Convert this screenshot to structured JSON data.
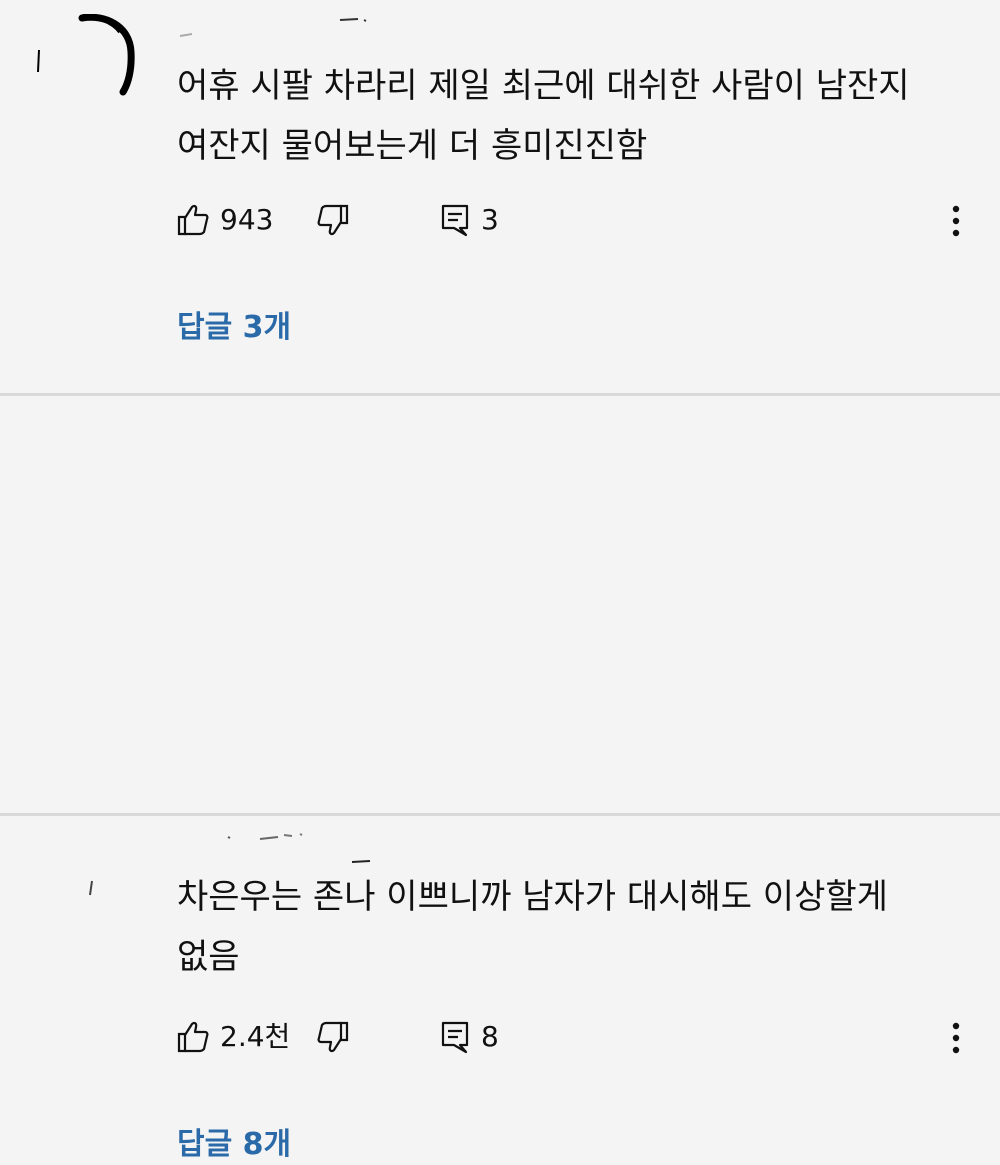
{
  "comments": [
    {
      "text": "어휴 시팔 차라리 제일 최근에 대쉬한 사람이 남잔지\n여잔지 물어보는게 더 흥미진진함",
      "likes": "943",
      "reply_count": "3",
      "replies_label": "답글 3개"
    },
    {
      "text": "차은우는 존나 이쁘니까 남자가 대시해도 이상할게\n없음",
      "likes": "2.4천",
      "reply_count": "8",
      "replies_label": "답글 8개"
    }
  ],
  "icons": {
    "like": "thumbs-up-icon",
    "dislike": "thumbs-down-icon",
    "reply": "reply-icon",
    "more": "more-vertical-icon"
  },
  "colors": {
    "background": "#f4f4f4",
    "text": "#111111",
    "link": "#2a6aa8",
    "divider": "#d9d9d9"
  }
}
